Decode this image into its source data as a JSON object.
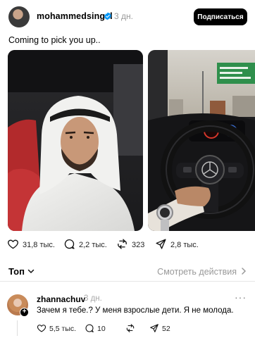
{
  "post": {
    "username": "mohammedsingel",
    "time": "3 дн.",
    "subscribe_label": "Подписаться",
    "caption": "Coming to pick you up..",
    "stats": {
      "likes": "31,8 тыс.",
      "comments": "2,2 тыс.",
      "reposts": "323",
      "shares": "2,8 тыс."
    }
  },
  "sort": {
    "label": "Топ",
    "view_activity": "Смотреть действия"
  },
  "comment": {
    "username": "zhannachuv",
    "time": "3 дн.",
    "more_label": "···",
    "text": "Зачем я тебе.? У меня взрослые дети. Я не молода.",
    "stats": {
      "likes": "5,5 тыс.",
      "comments": "10",
      "shares": "52"
    }
  },
  "icons": {
    "verified": "verified-badge-icon",
    "like": "heart-icon",
    "comment": "comment-bubble-icon",
    "repost": "repost-icon",
    "share": "send-icon",
    "sort": "chevron-down-icon",
    "view": "chevron-right-icon"
  },
  "colors": {
    "verified": "#0095f6",
    "muted": "#999999",
    "button_bg": "#000000"
  }
}
